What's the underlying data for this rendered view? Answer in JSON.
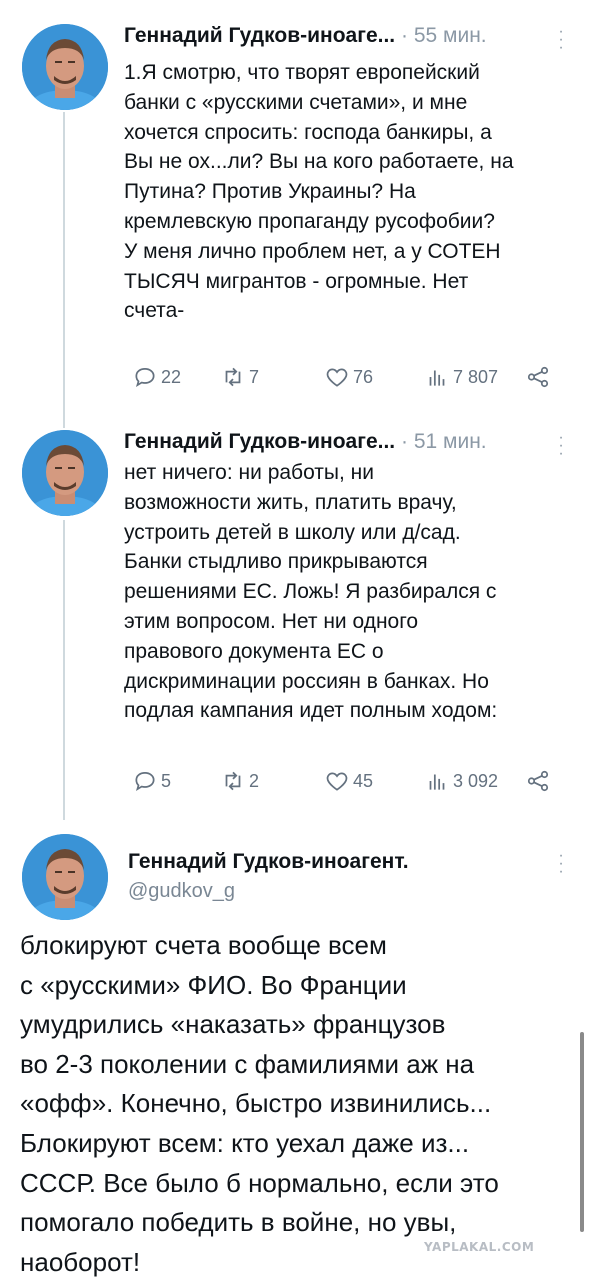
{
  "tweets": [
    {
      "author": "Геннадий Гудков-иноаге...",
      "dot": "·",
      "time": "55 мин.",
      "text": "1.Я смотрю, что творят европейский\nбанки с «русскими счетами», и мне\nхочется спросить: господа банкиры, а\nВы не ох...ли? Вы на кого работаете, на\nПутина? Против Украины? На\nкремлевскую пропаганду русофобии?\nУ меня лично проблем нет, а у СОТЕН\nТЫСЯЧ мигрантов - огромные. Нет\nсчета-",
      "replies": "22",
      "retweets": "7",
      "likes": "76",
      "views": "7 807"
    },
    {
      "author": "Геннадий Гудков-иноаге...",
      "dot": "·",
      "time": "51 мин.",
      "text": "нет ничего: ни работы, ни\nвозможности жить, платить врачу,\nустроить детей в школу или д/сад.\nБанки стыдливо прикрываются\nрешениями ЕС. Ложь! Я разбирался с\nэтим вопросом. Нет ни одного\nправового документа ЕС о\nдискриминации россиян в банках. Но\nподлая кампания идет полным ходом:",
      "replies": "5",
      "retweets": "2",
      "likes": "45",
      "views": "3 092"
    }
  ],
  "main_tweet": {
    "author": "Геннадий Гудков-иноагент.",
    "handle": "@gudkov_g",
    "text": "блокируют счета вообще всем\nс «русскими» ФИО. Во Франции\nумудрились «наказать» французов\nво 2-3 поколении с фамилиями аж на\n«офф». Конечно, быстро извинились...\nБлокируют всем: кто уехал даже из...\nСССР. Все было б нормально, если это\nпомогало победить в войне, но увы,\nнаоборот!"
  },
  "watermark": "YAPLAKAL.COM",
  "colors": {
    "text": "#0f1419",
    "secondary": "#64717f",
    "thread_line": "#cfd9de",
    "avatar_bg": "#3a93d6"
  }
}
